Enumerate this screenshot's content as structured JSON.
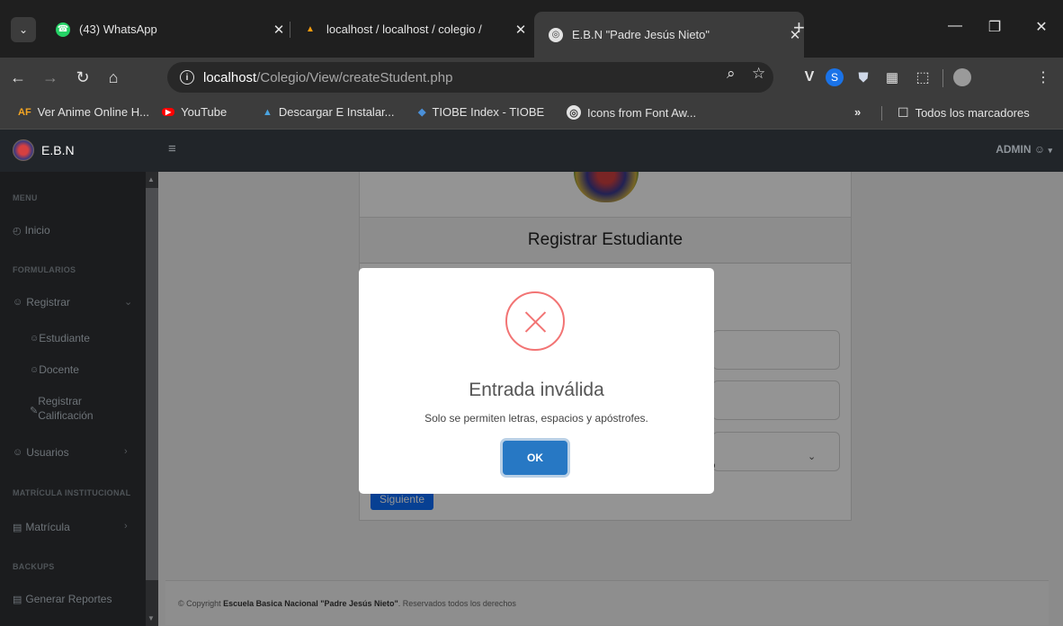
{
  "browser": {
    "tabs": [
      {
        "title": "(43) WhatsApp",
        "favicon": "whatsapp-icon"
      },
      {
        "title": "localhost / localhost / colegio /",
        "favicon": "phpmyadmin-icon"
      },
      {
        "title": "E.B.N \"Padre Jesús Nieto\"",
        "favicon": "globe-icon",
        "active": true
      }
    ],
    "new_tab_symbol": "+",
    "url_host": "localhost",
    "url_path": "/Colegio/View/createStudent.php",
    "bookmarks": [
      {
        "label": "Ver Anime Online H...",
        "icon": "AF"
      },
      {
        "label": "YouTube",
        "icon": "youtube-icon"
      },
      {
        "label": "Descargar E Instalar...",
        "icon": "download-icon"
      },
      {
        "label": "TIOBE Index - TIOBE",
        "icon": "tiobe-icon"
      },
      {
        "label": "Icons from Font Aw...",
        "icon": "globe-icon"
      }
    ],
    "bookmarks_overflow": "»",
    "all_bookmarks_label": "Todos los marcadores"
  },
  "app": {
    "brand": "E.B.N",
    "admin_label": "ADMIN",
    "sidebar": {
      "menu_heading": "MENU",
      "inicio": "Inicio",
      "formularios_heading": "FORMULARIOS",
      "registrar": "Registrar",
      "estudiante": "Estudiante",
      "docente": "Docente",
      "registrar_calificacion_1": "Registrar",
      "registrar_calificacion_2": "Calificación",
      "usuarios": "Usuarios",
      "matricula_heading": "MATRÍCULA INSTITUCIONAL",
      "matricula": "Matrícula",
      "backups_heading": "BACKUPS",
      "generar_reportes": "Generar Reportes"
    },
    "card_title": "Registrar Estudiante",
    "select_partial": "ero",
    "next_button": "Siguiente",
    "footer_prefix": "© Copyright ",
    "footer_school": "Escuela Basica Nacional \"Padre Jesús Nieto\"",
    "footer_suffix": ". Reservados todos los derechos"
  },
  "modal": {
    "title": "Entrada inválida",
    "message": "Solo se permiten letras, espacios y apóstrofes.",
    "ok_label": "OK"
  },
  "colors": {
    "error": "#f27474",
    "ok_button": "#2778c4",
    "primary": "#0d6efd"
  }
}
